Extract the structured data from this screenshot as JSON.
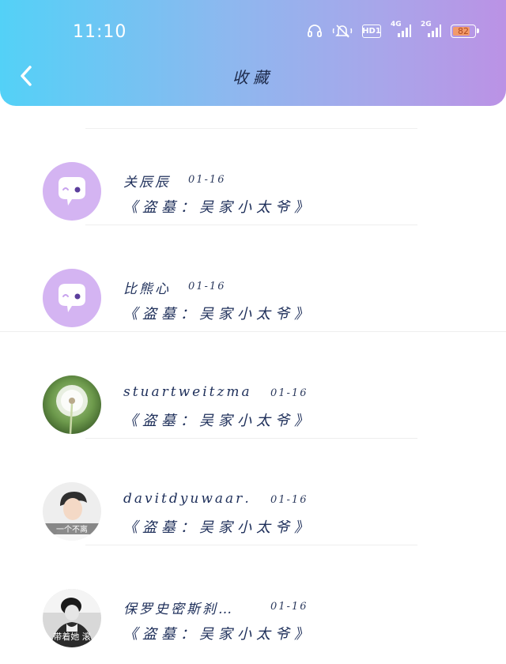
{
  "status_bar": {
    "time": "11:10",
    "hd_label": "HD1",
    "net1_label": "4G",
    "net2_label": "2G",
    "battery_level": "82",
    "battery_fraction": 0.82
  },
  "header": {
    "title": "收藏",
    "back_icon": "chevron-left-icon",
    "gradient_start": "#53d1f7",
    "gradient_end": "#bb92e5"
  },
  "favorites": [
    {
      "name": "关辰辰",
      "date": "01-16",
      "title": "《盗墓：吴家小太爷》",
      "avatar": "default-chat-avatar"
    },
    {
      "name": "比熊心",
      "date": "01-16",
      "title": "《盗墓：吴家小太爷》",
      "avatar": "default-chat-avatar"
    },
    {
      "name": "stuartweitzma…",
      "date": "01-16",
      "title": "《盗墓：吴家小太爷》",
      "avatar": "dandelion-photo"
    },
    {
      "name": "davitdyuwaar…",
      "date": "01-16",
      "title": "《盗墓：吴家小太爷》",
      "avatar": "person-photo"
    },
    {
      "name": "保罗史密斯刹…",
      "date": "01-16",
      "title": "《盗墓：吴家小太爷》",
      "avatar": "bw-person-photo"
    }
  ],
  "avatar_overlays": {
    "row4": "一个不离",
    "row5": "带着她 滚"
  },
  "colors": {
    "default_avatar_bg": "#d4b4f2",
    "text_primary": "#1e2f5a"
  }
}
